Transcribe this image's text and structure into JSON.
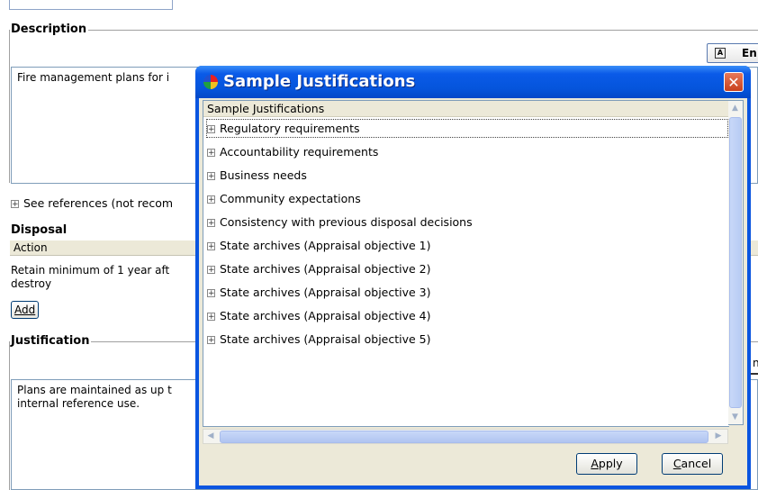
{
  "form": {
    "description": {
      "legend": "Description",
      "text": "Fire management plans for i",
      "enter_button_label": "En"
    },
    "see_references": "See references (not recom",
    "disposal": {
      "heading": "Disposal",
      "column_header": "Action",
      "action_line1": "Retain minimum of 1 year aft",
      "action_line2": "destroy",
      "add_button": "Add"
    },
    "justification": {
      "legend": "Justification",
      "text_line1": "Plans are maintained as up t",
      "text_line2": "internal reference use.",
      "right_fragment_1": "n",
      "right_fragment_2": "t"
    }
  },
  "dialog": {
    "title": "Sample Justifications",
    "tree_header": "Sample Justifications",
    "items": [
      {
        "label": "Regulatory requirements",
        "selected": true
      },
      {
        "label": "Accountability requirements",
        "selected": false
      },
      {
        "label": "Business needs",
        "selected": false
      },
      {
        "label": "Community expectations",
        "selected": false
      },
      {
        "label": "Consistency with previous disposal decisions",
        "selected": false
      },
      {
        "label": "State archives (Appraisal objective 1)",
        "selected": false
      },
      {
        "label": "State archives (Appraisal objective 2)",
        "selected": false
      },
      {
        "label": "State archives (Appraisal objective 3)",
        "selected": false
      },
      {
        "label": "State archives (Appraisal objective 4)",
        "selected": false
      },
      {
        "label": "State archives (Appraisal objective 5)",
        "selected": false
      }
    ],
    "apply_button": {
      "mnemonic": "A",
      "rest": "pply"
    },
    "cancel_button": {
      "mnemonic": "C",
      "rest": "ancel"
    },
    "expander_glyph": "+",
    "close_glyph": "✕"
  },
  "colors": {
    "titlebar": "#0a5ae8",
    "close_button": "#d4502c",
    "client_background": "#ece9d8",
    "scroll_thumb": "#c0d2f6"
  }
}
